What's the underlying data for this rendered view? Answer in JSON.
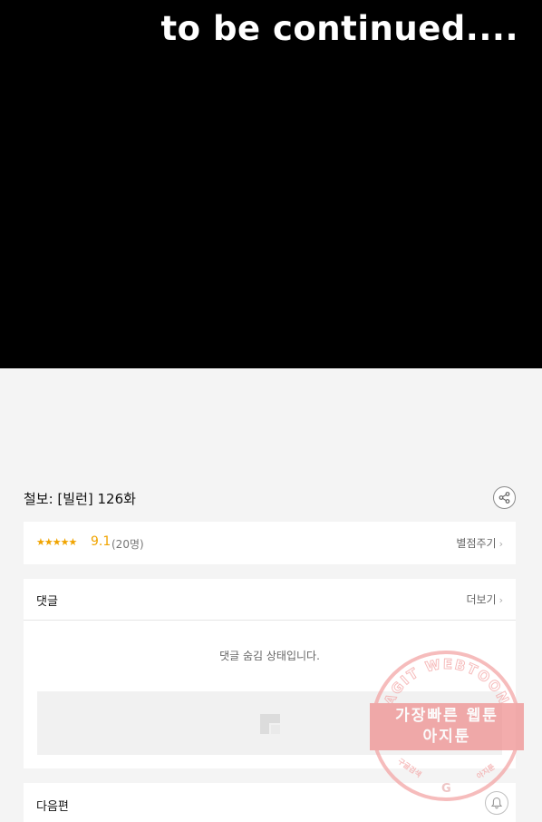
{
  "comic": {
    "text": "to be continued...."
  },
  "episode": {
    "title": "철보: [빌런] 126화"
  },
  "rating": {
    "stars": "★★★★★",
    "score": "9.1",
    "count": "(20명)",
    "rate_label": "별점주기",
    "chevron": "›",
    "accent_color": "#f0a400"
  },
  "comments": {
    "title": "댓글",
    "more_label": "더보기",
    "chevron": "›",
    "hidden_message": "댓글 숨김 상태입니다."
  },
  "next": {
    "title": "다음편"
  },
  "watermark": {
    "arc_text": "AGIT WEBTOON",
    "line1": "가장빠른 웹툰",
    "line2": "아지툰",
    "left_small": "구글검색",
    "right_small": "아지툰",
    "g_letter": "G"
  },
  "icons": {
    "share": "share-icon",
    "bell": "bell-icon",
    "ad_placeholder": "image-placeholder-icon"
  }
}
